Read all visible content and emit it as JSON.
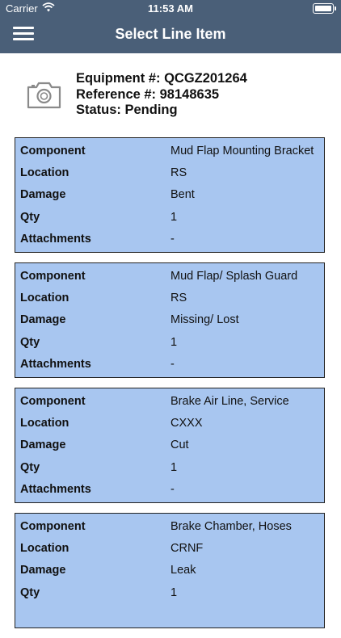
{
  "status_bar": {
    "carrier": "Carrier",
    "time": "11:53 AM"
  },
  "header": {
    "title": "Select Line Item",
    "background": "#4a5f78"
  },
  "info": {
    "equipment_line": "Equipment #: QCGZ201264",
    "reference_line": "Reference #: 98148635",
    "status_line": "Status: Pending"
  },
  "labels": {
    "component": "Component",
    "location": "Location",
    "damage": "Damage",
    "qty": "Qty",
    "attachments": "Attachments"
  },
  "items": [
    {
      "component": "Mud Flap Mounting Bracket",
      "location": "RS",
      "damage": "Bent",
      "qty": "1",
      "attachments": "-"
    },
    {
      "component": "Mud Flap/ Splash Guard",
      "location": "RS",
      "damage": "Missing/ Lost",
      "qty": "1",
      "attachments": "-"
    },
    {
      "component": "Brake Air Line, Service",
      "location": "CXXX",
      "damage": "Cut",
      "qty": "1",
      "attachments": "-"
    },
    {
      "component": "Brake Chamber, Hoses",
      "location": "CRNF",
      "damage": "Leak",
      "qty": "1",
      "attachments": ""
    }
  ],
  "colors": {
    "card_background": "#a8c6f0",
    "card_border": "#222222"
  },
  "icons": [
    "menu-icon",
    "camera-icon",
    "wifi-icon",
    "battery-icon"
  ]
}
